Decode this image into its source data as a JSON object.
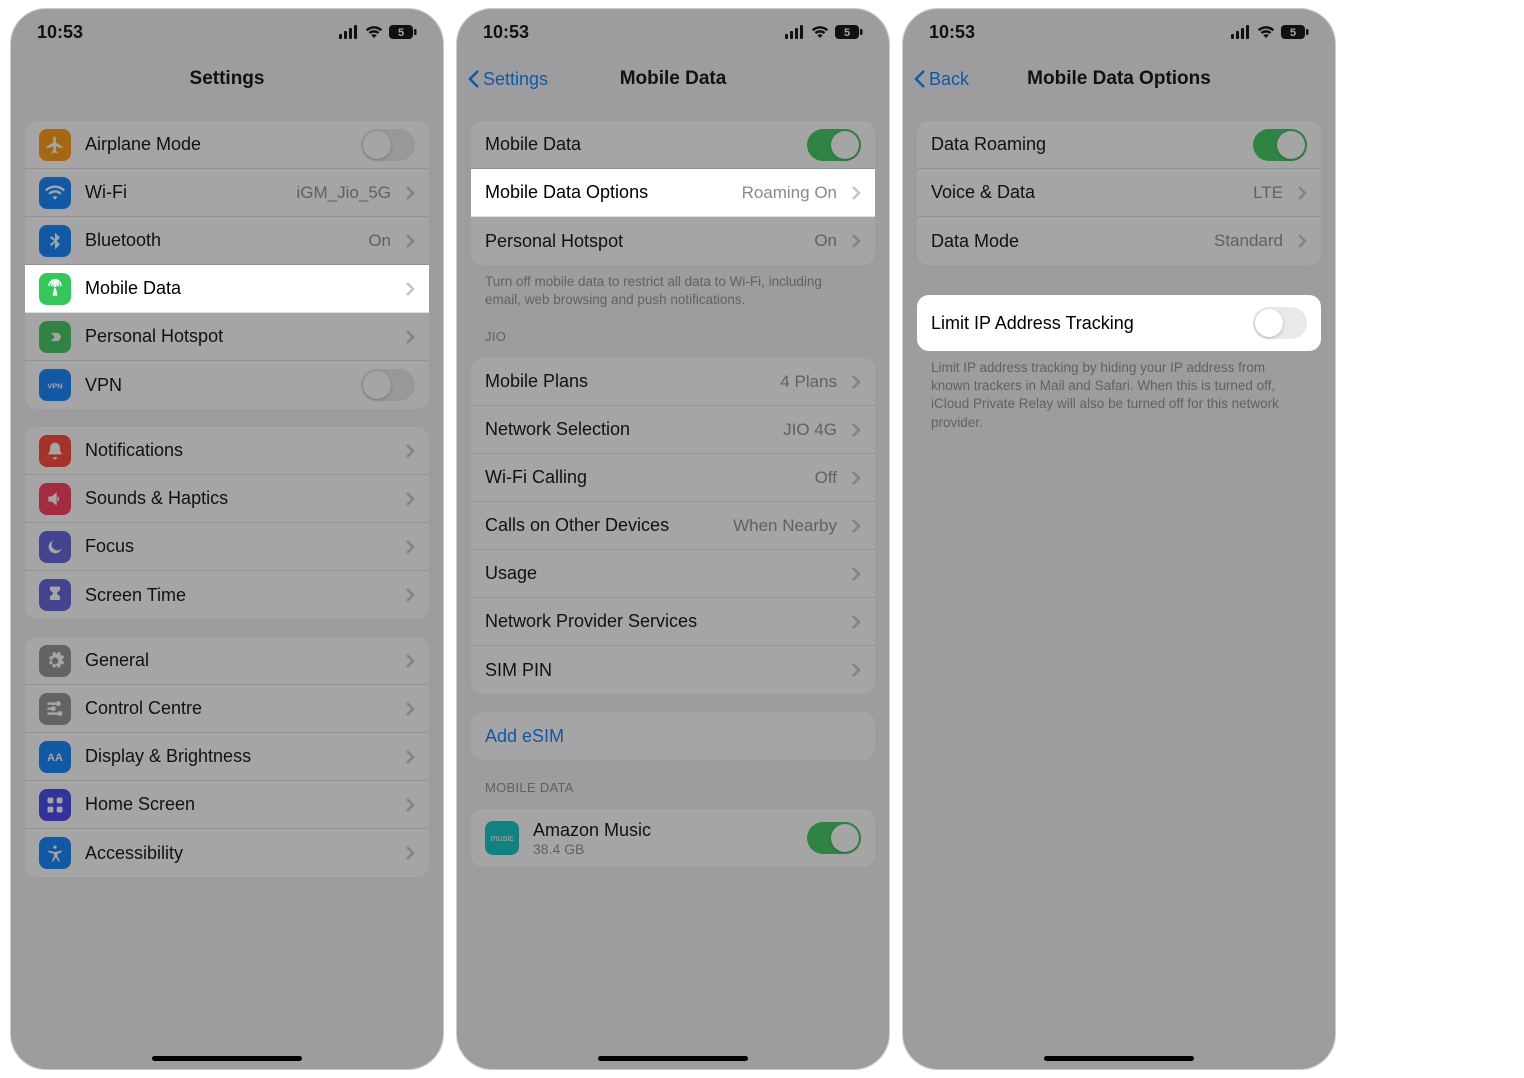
{
  "status": {
    "time": "10:53",
    "battery": "5"
  },
  "screen1": {
    "title": "Settings",
    "rows": {
      "airplane": "Airplane Mode",
      "wifi": "Wi-Fi",
      "wifi_val": "iGM_Jio_5G",
      "bluetooth": "Bluetooth",
      "bluetooth_val": "On",
      "mobile_data": "Mobile Data",
      "hotspot": "Personal Hotspot",
      "vpn": "VPN",
      "notifications": "Notifications",
      "sounds": "Sounds & Haptics",
      "focus": "Focus",
      "screentime": "Screen Time",
      "general": "General",
      "control": "Control Centre",
      "display": "Display & Brightness",
      "home": "Home Screen",
      "accessibility": "Accessibility"
    }
  },
  "screen2": {
    "back": "Settings",
    "title": "Mobile Data",
    "rows": {
      "mobile_data": "Mobile Data",
      "options": "Mobile Data Options",
      "options_val": "Roaming On",
      "hotspot": "Personal Hotspot",
      "hotspot_val": "On"
    },
    "footer1": "Turn off mobile data to restrict all data to Wi-Fi, including email, web browsing and push notifications.",
    "jio_header": "JIO",
    "jio": {
      "plans": "Mobile Plans",
      "plans_val": "4 Plans",
      "network": "Network Selection",
      "network_val": "JIO 4G",
      "wificall": "Wi-Fi Calling",
      "wificall_val": "Off",
      "other": "Calls on Other Devices",
      "other_val": "When Nearby",
      "usage": "Usage",
      "provider": "Network Provider Services",
      "sim": "SIM PIN"
    },
    "esim": "Add eSIM",
    "md_header": "MOBILE DATA",
    "app": {
      "name": "Amazon Music",
      "size": "38.4 GB",
      "icon_text": "music"
    }
  },
  "screen3": {
    "back": "Back",
    "title": "Mobile Data Options",
    "rows": {
      "roaming": "Data Roaming",
      "voice": "Voice & Data",
      "voice_val": "LTE",
      "mode": "Data Mode",
      "mode_val": "Standard"
    },
    "limit": "Limit IP Address Tracking",
    "limit_footer": "Limit IP address tracking by hiding your IP address from known trackers in Mail and Safari. When this is turned off, iCloud Private Relay will also be turned off for this network provider."
  },
  "colors": {
    "orange": "#ff9500",
    "blue": "#007aff",
    "green": "#34c759",
    "green2": "#30d158",
    "red": "#ff3b30",
    "red2": "#ff2d55",
    "indigo": "#5856d6",
    "purple": "#af52de",
    "gray": "#8e8e93",
    "blue2": "#0a84ff",
    "teal": "#00c3c1"
  }
}
